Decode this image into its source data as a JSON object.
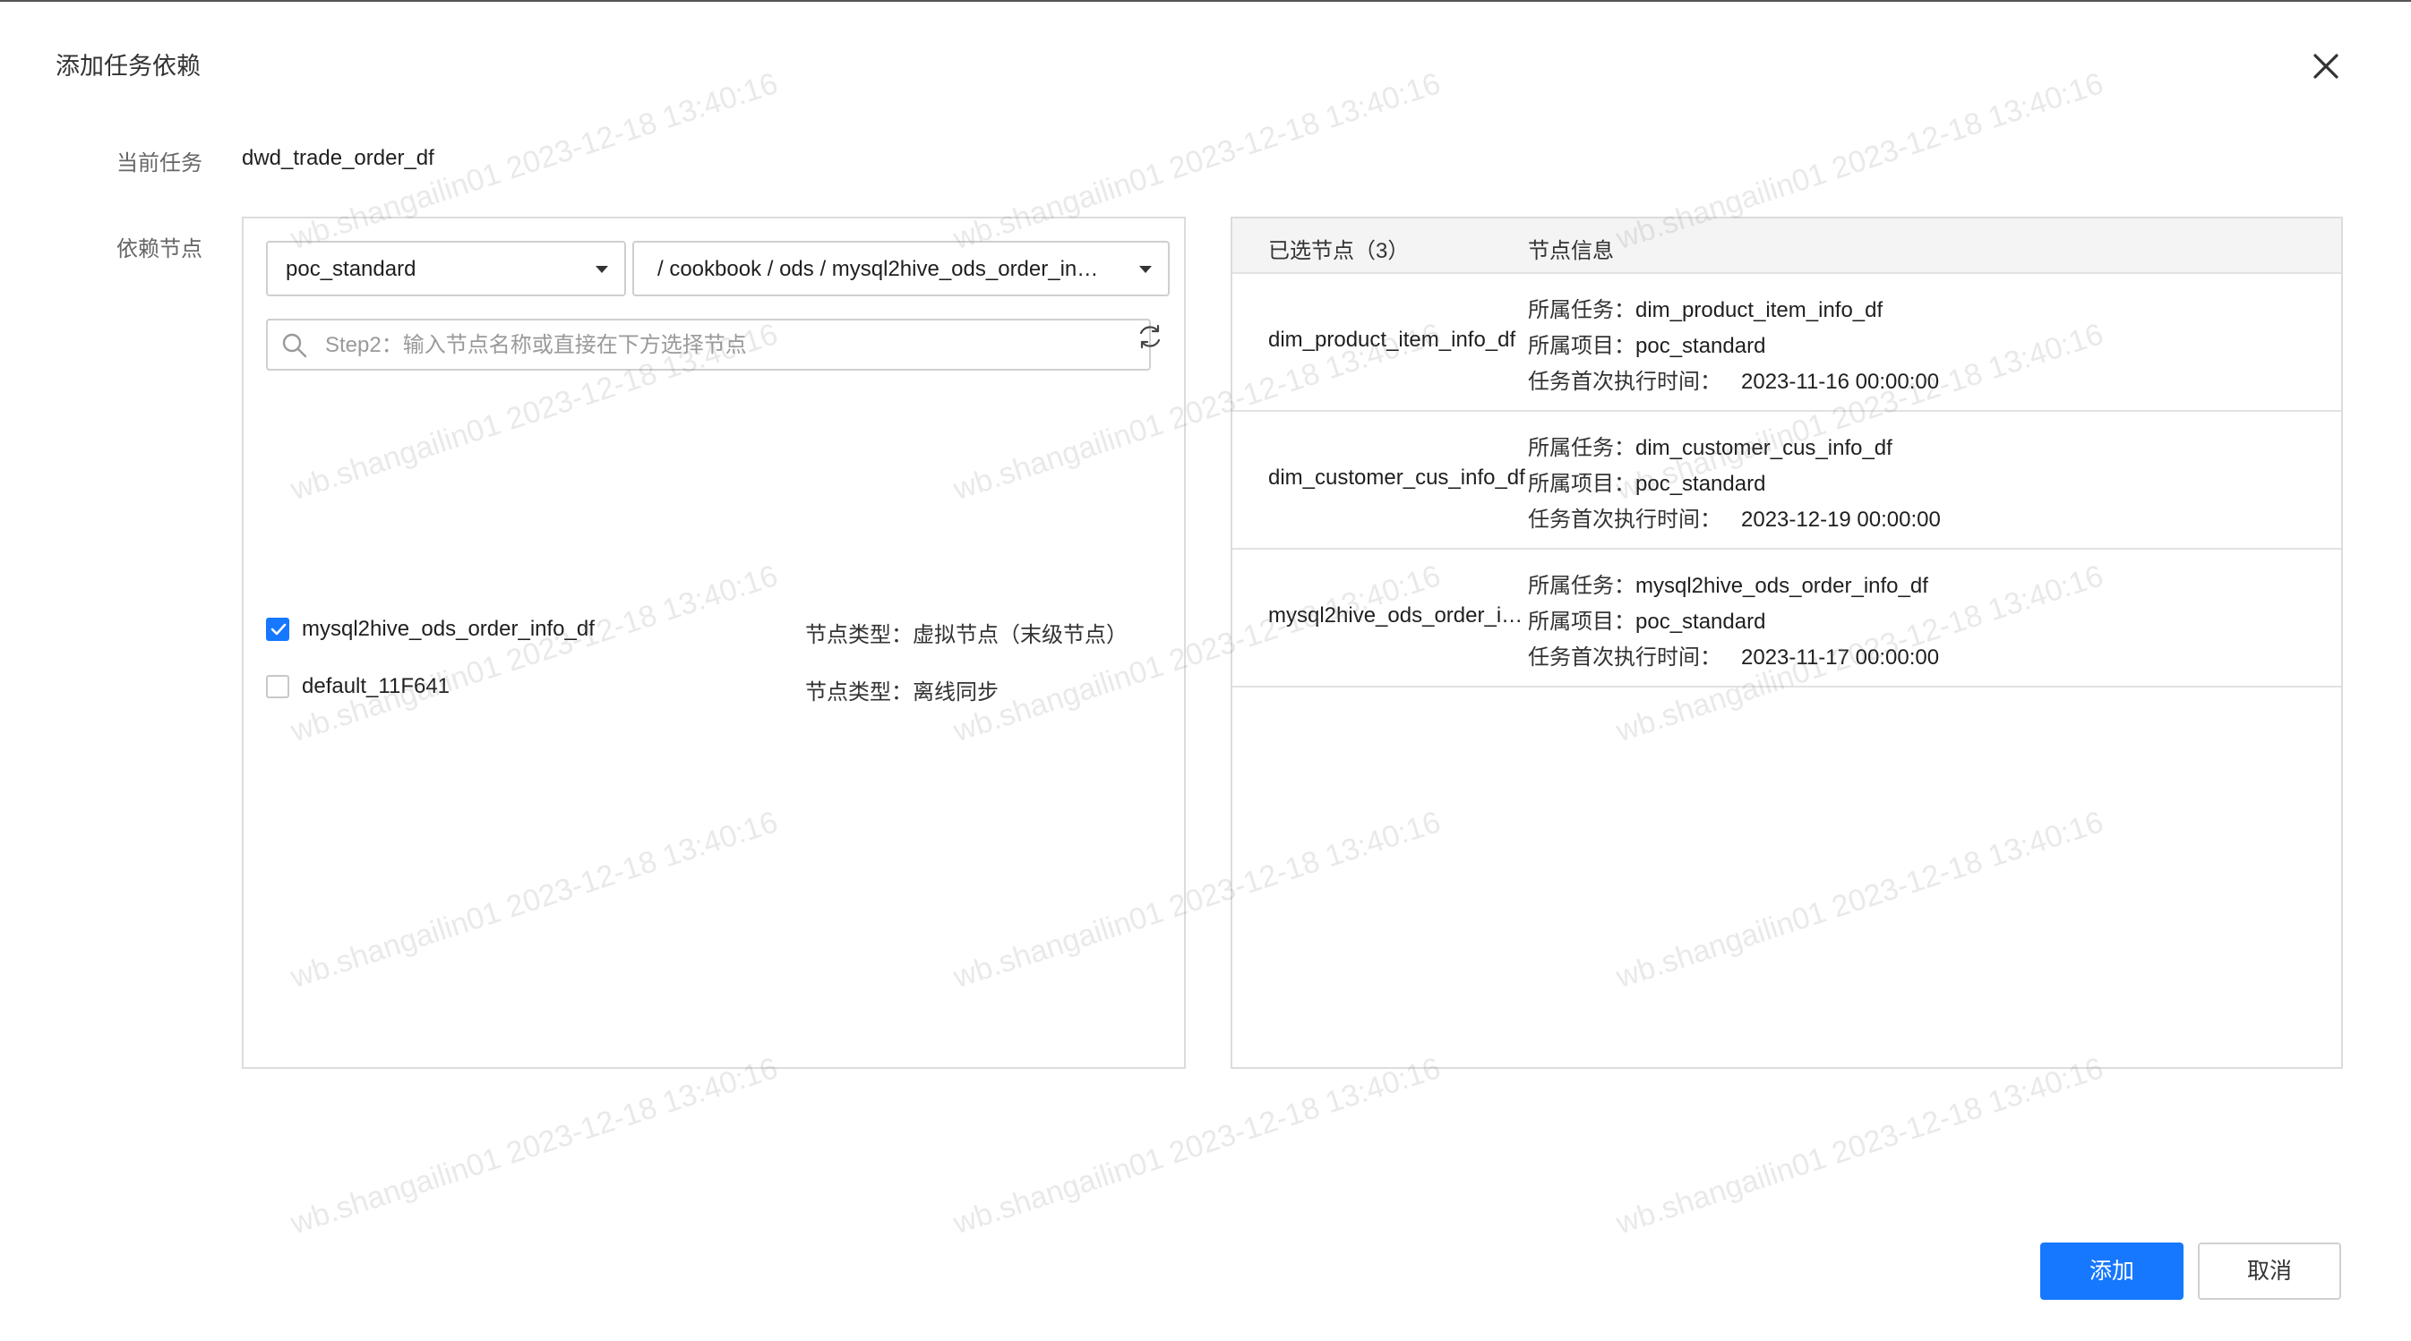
{
  "dialog": {
    "title": "添加任务依赖"
  },
  "form": {
    "current_task_label": "当前任务",
    "current_task_value": "dwd_trade_order_df",
    "dependency_label": "依赖节点"
  },
  "selectors": {
    "project": "poc_standard",
    "path": "/ cookbook / ods / mysql2hive_ods_order_in…"
  },
  "search": {
    "placeholder": "Step2：输入节点名称或直接在下方选择节点"
  },
  "nodes": [
    {
      "name": "mysql2hive_ods_order_info_df",
      "type": "节点类型：虚拟节点（末级节点）",
      "checked": true
    },
    {
      "name": "default_11F641",
      "type": "节点类型：离线同步",
      "checked": false
    }
  ],
  "selected": {
    "header_count": "已选节点（3）",
    "header_info": "节点信息",
    "items": [
      {
        "name": "dim_product_item_info_df",
        "task_key": "所属任务：",
        "task": "dim_product_item_info_df",
        "project_key": "所属项目：",
        "project": "poc_standard",
        "time_key": "任务首次执行时间：",
        "time": "2023-11-16 00:00:00"
      },
      {
        "name": "dim_customer_cus_info_df",
        "task_key": "所属任务：",
        "task": "dim_customer_cus_info_df",
        "project_key": "所属项目：",
        "project": "poc_standard",
        "time_key": "任务首次执行时间：",
        "time": "2023-12-19 00:00:00"
      },
      {
        "name": "mysql2hive_ods_order_i…",
        "task_key": "所属任务：",
        "task": "mysql2hive_ods_order_info_df",
        "project_key": "所属项目：",
        "project": "poc_standard",
        "time_key": "任务首次执行时间：",
        "time": "2023-11-17 00:00:00"
      }
    ]
  },
  "buttons": {
    "add": "添加",
    "cancel": "取消"
  },
  "watermark": "wb.shangailin01 2023-12-18 13:40:16",
  "colors": {
    "primary": "#1677ff",
    "border": "#dcdcdc",
    "header_bg": "#f4f4f4"
  }
}
